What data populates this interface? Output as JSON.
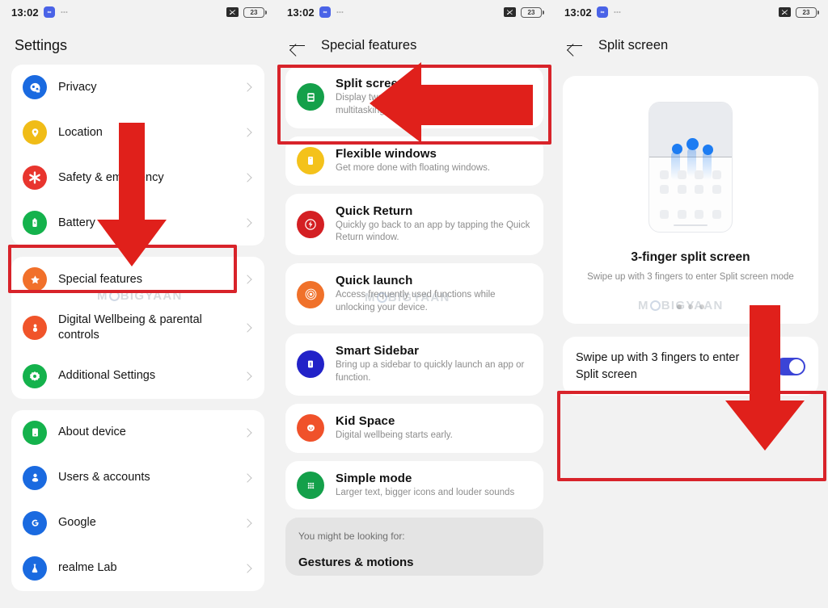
{
  "status_bar": {
    "time": "13:02",
    "badge_icon": "app-badge-icon",
    "overflow": "···",
    "mute_icon": "mute-icon",
    "battery_percent": "23"
  },
  "watermark": {
    "text_before": "M",
    "text_after": "BIGYAAN"
  },
  "panel1": {
    "title": "Settings",
    "groups": [
      {
        "items": [
          {
            "label": "Privacy",
            "icon": "privacy-icon",
            "color": "#1a6ae0"
          },
          {
            "label": "Location",
            "icon": "location-icon",
            "color": "#f0bc17"
          },
          {
            "label": "Safety & emergency",
            "icon": "safety-emergency-icon",
            "color": "#e8352e"
          },
          {
            "label": "Battery",
            "icon": "battery-icon",
            "color": "#14b24c"
          }
        ]
      },
      {
        "items": [
          {
            "label": "Special features",
            "icon": "special-features-icon",
            "color": "#f1702a"
          },
          {
            "label": "Digital Wellbeing & parental controls",
            "icon": "digital-wellbeing-icon",
            "color": "#f0542a"
          },
          {
            "label": "Additional Settings",
            "icon": "additional-settings-icon",
            "color": "#14b24c"
          }
        ]
      },
      {
        "items": [
          {
            "label": "About device",
            "icon": "about-device-icon",
            "color": "#14b24c"
          },
          {
            "label": "Users & accounts",
            "icon": "users-accounts-icon",
            "color": "#1a6ae0"
          },
          {
            "label": "Google",
            "icon": "google-icon",
            "color": "#1a6ae0"
          },
          {
            "label": "realme Lab",
            "icon": "realme-lab-icon",
            "color": "#1a6ae0"
          }
        ]
      }
    ]
  },
  "panel2": {
    "title": "Special features",
    "back_icon": "back-arrow-icon",
    "features": [
      {
        "title": "Split screen",
        "desc": "Display two apps on the screen for easier multitasking.",
        "icon": "split-screen-icon",
        "color": "#14a04a"
      },
      {
        "title": "Flexible windows",
        "desc": "Get more done with floating windows.",
        "icon": "flexible-windows-icon",
        "color": "#f4c21b"
      },
      {
        "title": "Quick Return",
        "desc": "Quickly go back to an app by tapping the Quick Return window.",
        "icon": "quick-return-icon",
        "color": "#d41f23"
      },
      {
        "title": "Quick launch",
        "desc": "Access frequently used functions while unlocking your device.",
        "icon": "quick-launch-icon",
        "color": "#f0712a"
      },
      {
        "title": "Smart Sidebar",
        "desc": "Bring up a sidebar to quickly launch an app or function.",
        "icon": "smart-sidebar-icon",
        "color": "#2222c8"
      },
      {
        "title": "Kid Space",
        "desc": "Digital wellbeing starts early.",
        "icon": "kid-space-icon",
        "color": "#f0512a"
      },
      {
        "title": "Simple mode",
        "desc": "Larger text, bigger icons and louder sounds",
        "icon": "simple-mode-icon",
        "color": "#14a04a"
      }
    ],
    "looking_for": {
      "heading": "You might be looking for:",
      "item": "Gestures & motions"
    }
  },
  "panel3": {
    "title": "Split screen",
    "back_icon": "back-arrow-icon",
    "hero": {
      "illustration": "three-finger-swipe-illustration",
      "title": "3-finger split screen",
      "subtitle": "Swipe up with 3 fingers to enter Split screen mode",
      "page_dots": 3,
      "active_dot": 0
    },
    "toggle_row": {
      "label": "Swipe up with 3 fingers to enter Split screen",
      "toggle_state": "on",
      "toggle_color": "#3b44d6"
    }
  },
  "annotations": {
    "highlight_color": "#d8232a",
    "boxes": [
      {
        "name": "special-features-highlight",
        "panel": 1
      },
      {
        "name": "split-screen-highlight",
        "panel": 2
      },
      {
        "name": "toggle-row-highlight",
        "panel": 3
      }
    ],
    "arrows": [
      {
        "name": "down-arrow-special-features",
        "direction": "down"
      },
      {
        "name": "left-arrow-split-screen",
        "direction": "left"
      },
      {
        "name": "down-arrow-toggle",
        "direction": "down"
      }
    ]
  }
}
